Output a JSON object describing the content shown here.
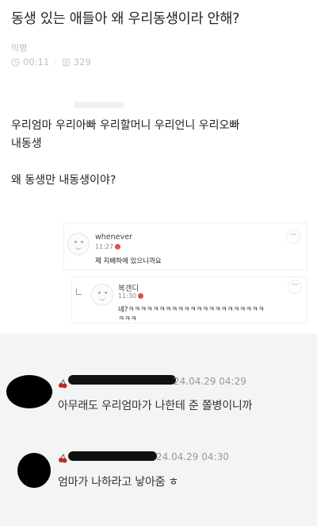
{
  "post": {
    "title": "동생 있는 애들아 왜 우리동생이라 안해?",
    "author": "익명",
    "time": "00:11",
    "views": "329",
    "body_lines": [
      "우리엄마 우리아빠 우리할머니 우리언니 우리오빠",
      "내동생",
      "",
      "왜 동생만 내동생이야?"
    ]
  },
  "embedded_comments": [
    {
      "name": "whenever",
      "time": "11:27",
      "text": "제 지배하에 있으니까요",
      "more": "···"
    },
    {
      "name": "복갠디",
      "time": "11:30",
      "text_line1": "네?ㅋㅋㅋㅋㅋㅋㅋㅋㅋㅋㅋㅋㅋㅋㅋㅋㅋㅋㅋㅋㅋㅋ",
      "text_line2": "ㅋㅋㅋ",
      "more": "···"
    }
  ],
  "comments": [
    {
      "date": "24.04.29 04:29",
      "text": "아무래도 우리엄마가 나한테 준 쫄병이니까"
    },
    {
      "date": "24.04.29 04:30",
      "text": "엄마가 나하라고 낳아줌 ㅎ"
    }
  ],
  "colors": {
    "badge": "#e24b4b",
    "cherry": "#c0282b",
    "lower_bg": "#f4f4f4"
  }
}
